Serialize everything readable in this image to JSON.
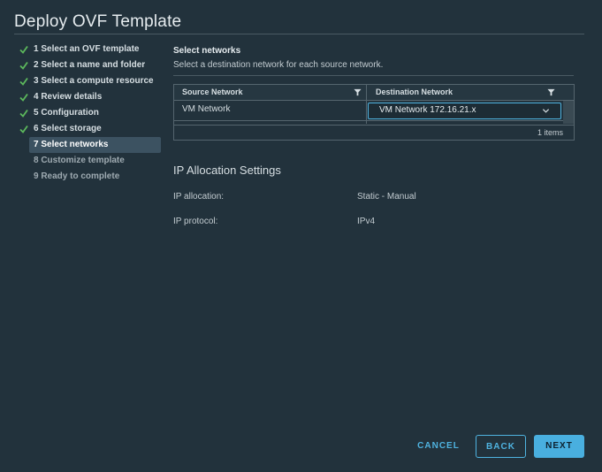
{
  "dialog": {
    "title": "Deploy OVF Template"
  },
  "steps": [
    {
      "label": "1 Select an OVF template",
      "state": "done"
    },
    {
      "label": "2 Select a name and folder",
      "state": "done"
    },
    {
      "label": "3 Select a compute resource",
      "state": "done"
    },
    {
      "label": "4 Review details",
      "state": "done"
    },
    {
      "label": "5 Configuration",
      "state": "done"
    },
    {
      "label": "6 Select storage",
      "state": "done"
    },
    {
      "label": "7 Select networks",
      "state": "active"
    },
    {
      "label": "8 Customize template",
      "state": "pending"
    },
    {
      "label": "9 Ready to complete",
      "state": "pending"
    }
  ],
  "networks": {
    "title": "Select networks",
    "description": "Select a destination network for each source network.",
    "columns": {
      "source": "Source Network",
      "destination": "Destination Network"
    },
    "rows": [
      {
        "source": "VM Network",
        "destination": "VM Network 172.16.21.x"
      }
    ],
    "items_count": "1 items"
  },
  "ip_settings": {
    "title": "IP Allocation Settings",
    "allocation_label": "IP allocation:",
    "allocation_value": "Static - Manual",
    "protocol_label": "IP protocol:",
    "protocol_value": "IPv4"
  },
  "buttons": {
    "cancel": "CANCEL",
    "back": "BACK",
    "next": "NEXT"
  },
  "colors": {
    "accent": "#49afdf",
    "check": "#5cb85c",
    "background": "#22323c"
  },
  "icons": {
    "step_done": "check-icon",
    "filter": "filter-icon",
    "dropdown": "chevron-down-icon"
  }
}
